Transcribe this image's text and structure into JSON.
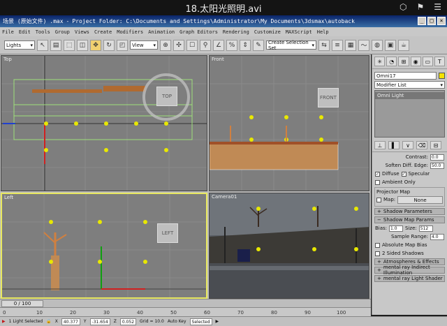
{
  "player": {
    "title": "18.太阳光照明.avi"
  },
  "window": {
    "title": "场景 (原始文件) .max",
    "project_folder": "Project Folder: C:\\Documents and Settings\\Administrator\\My Documents\\3dsmax\\autoback"
  },
  "menu": [
    "File",
    "Edit",
    "Tools",
    "Group",
    "Views",
    "Create",
    "Modifiers",
    "Animation",
    "Graph Editors",
    "Rendering",
    "Customize",
    "MAXScript",
    "Help"
  ],
  "toolbar": {
    "selection_filter": "Lights",
    "reference_coord": "View",
    "named_selection": "Create Selection Set"
  },
  "viewports": {
    "top": {
      "label": "Top",
      "cube": "TOP"
    },
    "front": {
      "label": "Front",
      "cube": "FRONT"
    },
    "left": {
      "label": "Left",
      "cube": "LEFT"
    },
    "camera": {
      "label": "Camera01"
    }
  },
  "command_panel": {
    "object_name": "Omni17",
    "object_color": "#f5e200",
    "modifier_list": "Modifier List",
    "stack_item": "Omni Light",
    "contrast_label": "Contrast:",
    "contrast_value": "0.0",
    "soften_label": "Soften Diff. Edge:",
    "soften_value": "50.0",
    "diffuse_label": "Diffuse",
    "specular_label": "Specular",
    "ambient_label": "Ambient Only",
    "projector_group": "Projector Map",
    "map_label": "Map:",
    "map_button": "None",
    "shadow_params": "Shadow Parameters",
    "shadow_map_params": "Shadow Map Params",
    "bias_label": "Bias:",
    "bias_value": "1.0",
    "size_label": "Size:",
    "size_value": "512",
    "sample_range_label": "Sample Range:",
    "sample_range_value": "4.0",
    "absolute_bias_label": "Absolute Map Bias",
    "two_sided_label": "2 Sided Shadows",
    "atmos_rollout": "Atmospheres & Effects",
    "mr_indirect_rollout": "mental ray Indirect Illumination",
    "mr_shader_rollout": "mental ray Light Shader"
  },
  "timeline": {
    "frame_display": "0 / 100",
    "ticks": [
      "0",
      "10",
      "20",
      "30",
      "40",
      "50",
      "60",
      "70",
      "80",
      "90",
      "100"
    ]
  },
  "status": {
    "selected_text": "1 Light Selected",
    "x_label": "X",
    "x_value": "40.377",
    "y_label": "Y",
    "y_value": "-31.654",
    "z_label": "Z",
    "z_value": "0.052",
    "grid_label": "Grid = 10.0",
    "autokey_label": "Auto Key",
    "selected_dropdown": "Selected"
  }
}
